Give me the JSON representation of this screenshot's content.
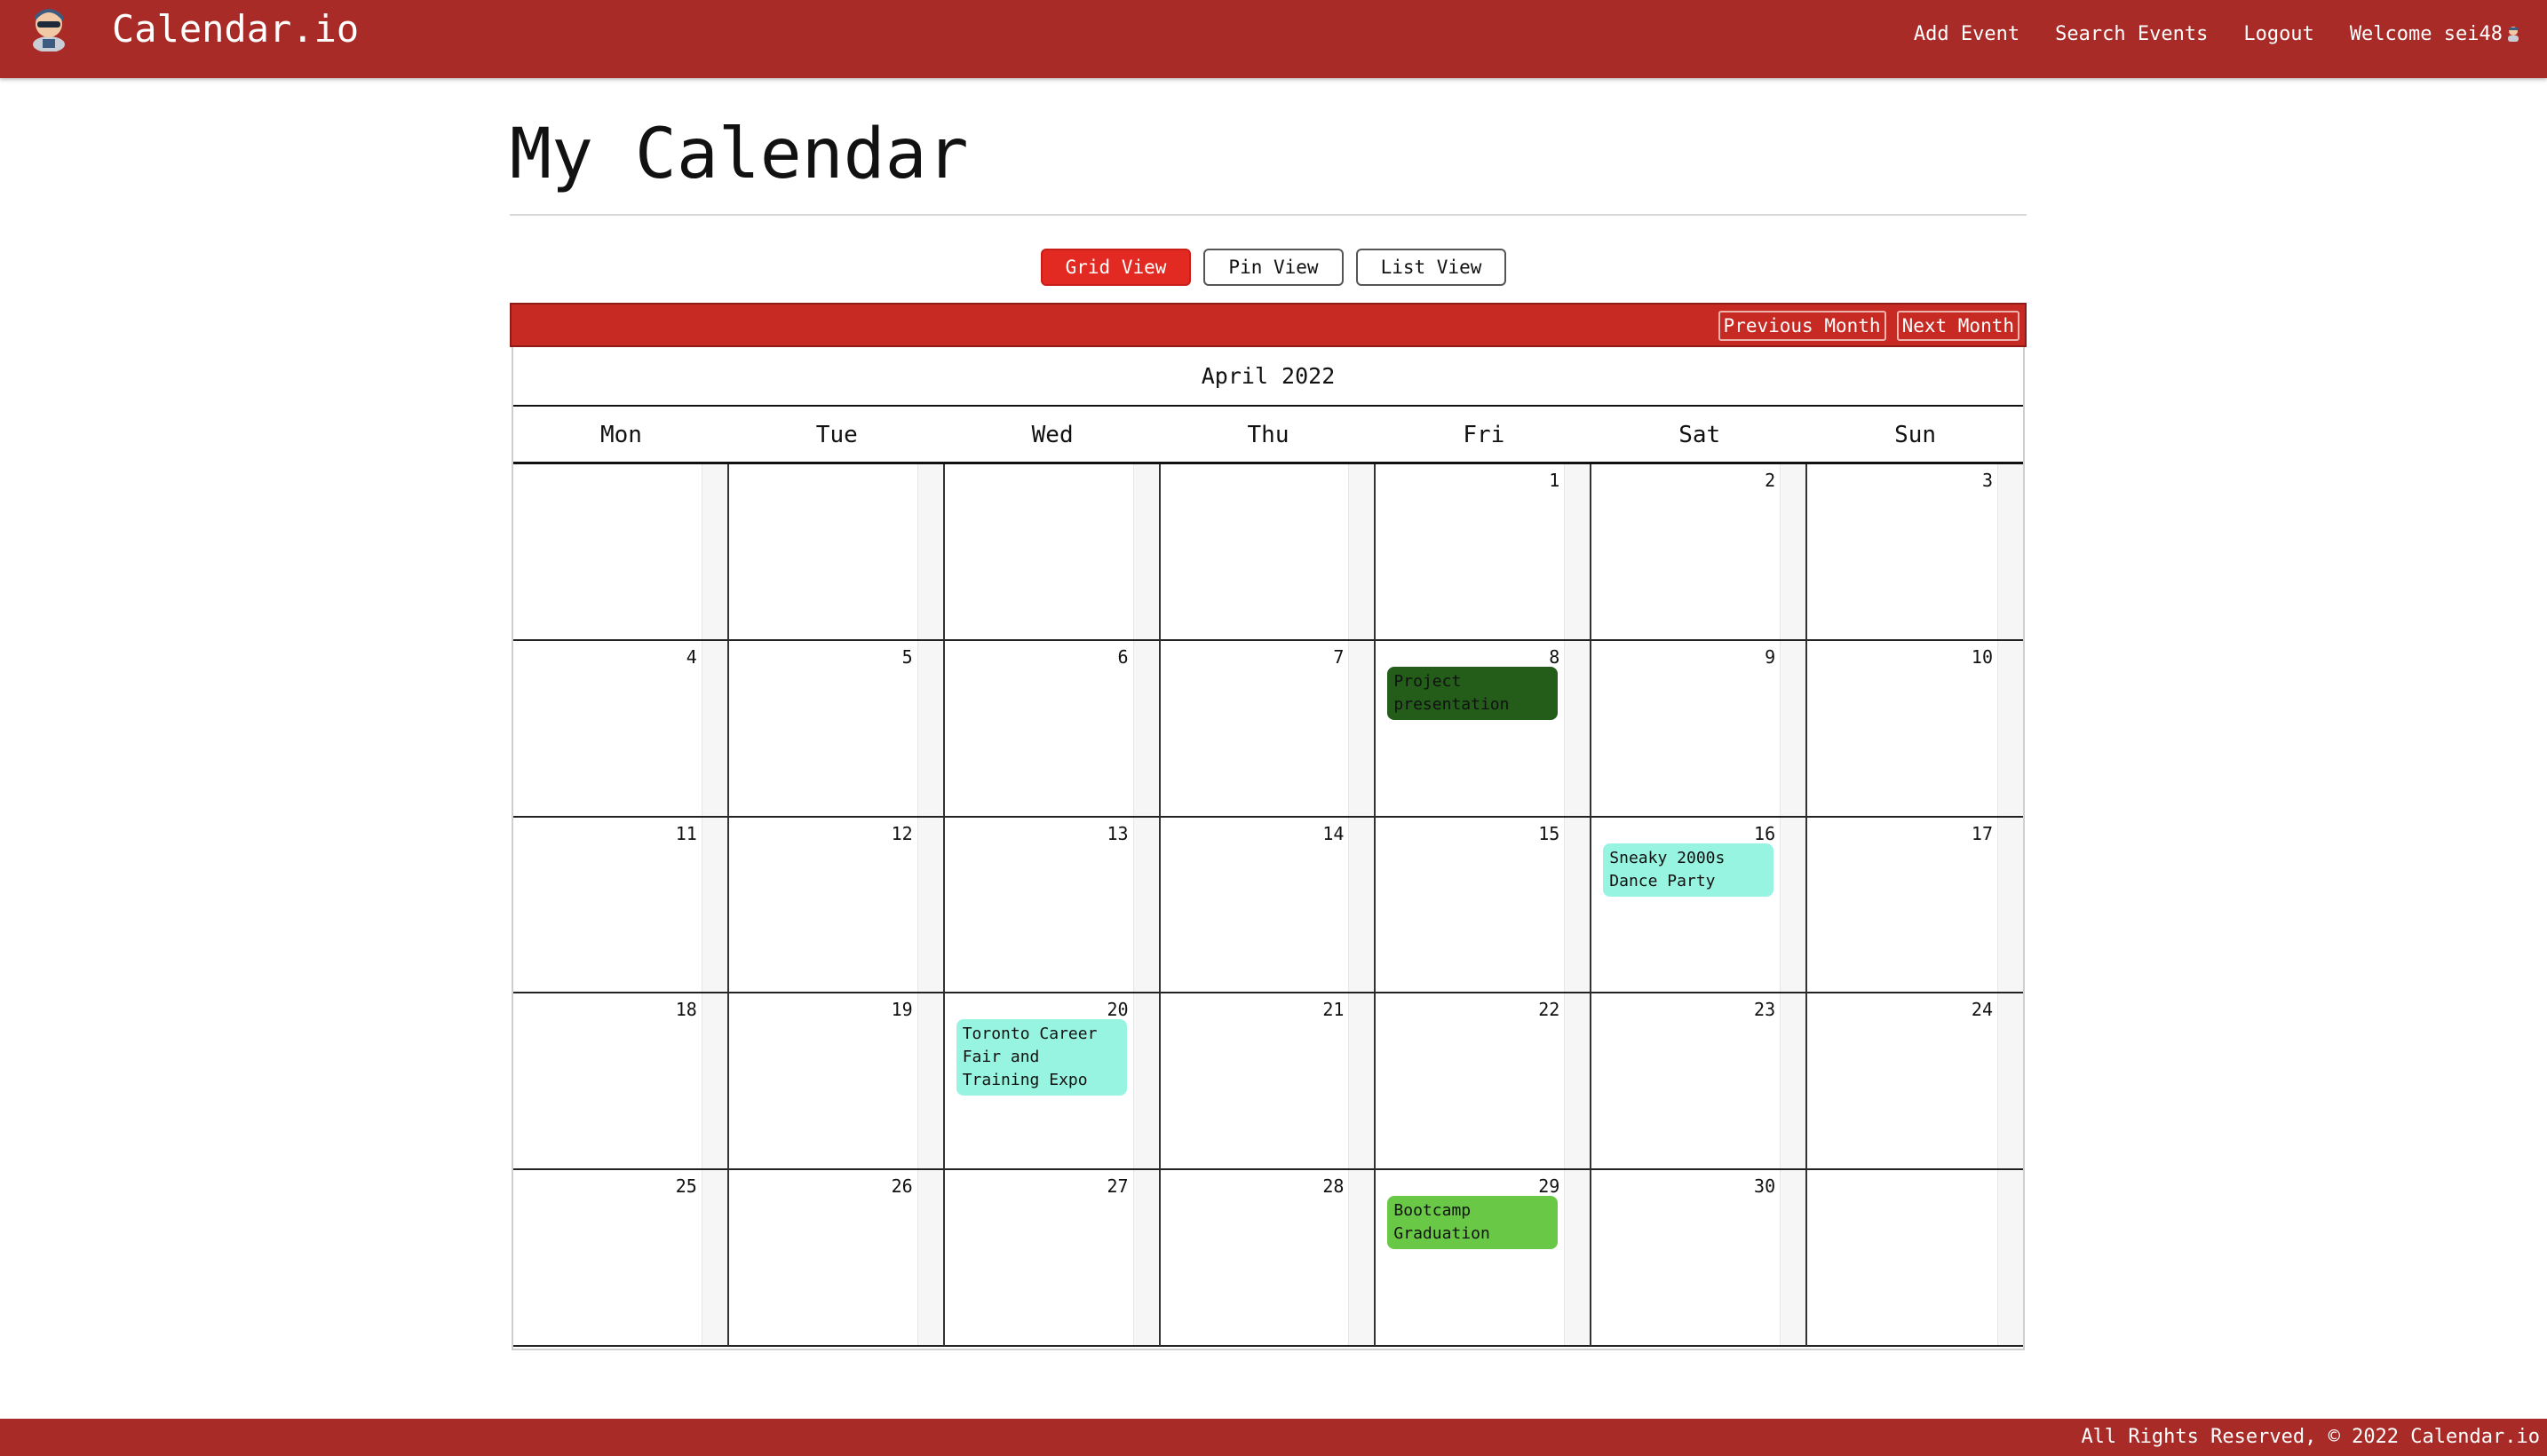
{
  "navbar": {
    "brand": "Calendar.io",
    "links": {
      "add_event": "Add Event",
      "search_events": "Search Events",
      "logout": "Logout",
      "welcome": "Welcome sei48"
    },
    "color": "#a82b27"
  },
  "page_title": "My Calendar",
  "views": {
    "grid": "Grid View",
    "pin": "Pin View",
    "list": "List View",
    "active": "grid"
  },
  "nav_buttons": {
    "previous": "Previous Month",
    "next": "Next Month"
  },
  "month_label": "April 2022",
  "weekdays": [
    "Mon",
    "Tue",
    "Wed",
    "Thu",
    "Fri",
    "Sat",
    "Sun"
  ],
  "weeks": [
    [
      "",
      "",
      "",
      "",
      "1",
      "2",
      "3"
    ],
    [
      "4",
      "5",
      "6",
      "7",
      "8",
      "9",
      "10"
    ],
    [
      "11",
      "12",
      "13",
      "14",
      "15",
      "16",
      "17"
    ],
    [
      "18",
      "19",
      "20",
      "21",
      "22",
      "23",
      "24"
    ],
    [
      "25",
      "26",
      "27",
      "28",
      "29",
      "30",
      ""
    ]
  ],
  "events": [
    {
      "day": "8",
      "title": "Project presentation",
      "color": "#235d19"
    },
    {
      "day": "16",
      "title": "Sneaky 2000s Dance Party",
      "color": "#97f4e0"
    },
    {
      "day": "20",
      "title": "Toronto Career Fair and Training Expo",
      "color": "#97f4e0"
    },
    {
      "day": "29",
      "title": "Bootcamp Graduation",
      "color": "#69c946"
    }
  ],
  "footer": "All Rights Reserved, © 2022 Calendar.io",
  "icons": {
    "brand": "hacker-avatar-icon",
    "welcome": "user-avatar-icon"
  }
}
